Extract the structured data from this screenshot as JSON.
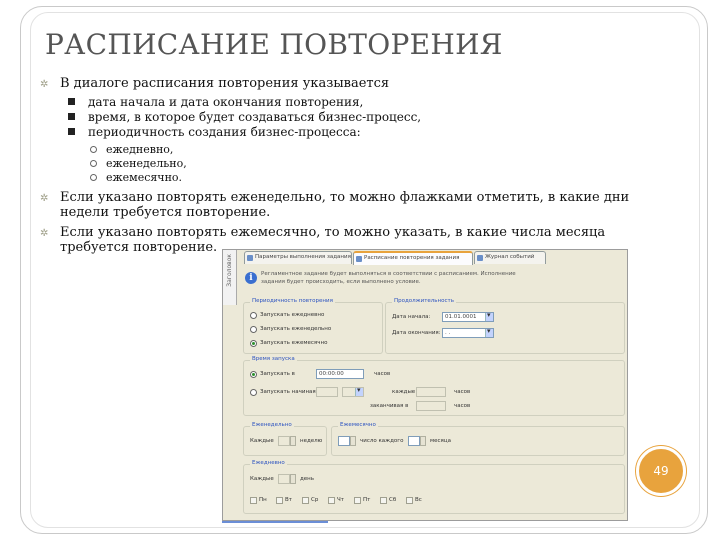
{
  "slide": {
    "title": "РАСПИСАНИЕ ПОВТОРЕНИЯ",
    "page_number": "49",
    "accent_color": "#e8a33d",
    "bullet_icon": "diamond-bullet-icon"
  },
  "bullets": {
    "intro": "В диалоге расписания повторения указывается",
    "sub": [
      "дата начала и дата окончания повторения,",
      "время, в которое будет создаваться бизнес-процесс,",
      "периодичность создания бизнес-процесса:"
    ],
    "subsub": [
      "ежедневно,",
      "еженедельно,",
      "ежемесячно."
    ],
    "weekly_line1": "Если указано повторять еженедельно, то можно флажками отметить, в какие дни",
    "weekly_line2": "недели требуется повторение.",
    "monthly_line1": "Если указано повторять ежемесячно, то можно указать, в какие числа месяца",
    "monthly_line2": "требуется повторение."
  },
  "dialog": {
    "side_label": "Заголовок",
    "tabs": [
      "Параметры выполнения задания",
      "Расписание повторения задания",
      "Журнал событий"
    ],
    "info_text": "Регламентное задание будет выполняться в соответствии с расписанием. Исполнение задания будет происходить, если выполнено условие.",
    "period_group": {
      "title": "Периодичность повторения",
      "options": [
        "Запускать ежедневно",
        "Запускать еженедельно",
        "Запускать ежемесячно"
      ]
    },
    "dates_group": {
      "title": "Продолжительность",
      "start_label": "Дата начала:",
      "start_value": "01.01.0001",
      "end_label": "Дата окончания:",
      "end_value": ". ."
    },
    "time_group": {
      "title": "Время запуска",
      "run_at_label": "Запускать в",
      "run_at_value": "00:00:00",
      "run_from_label": "Запускать начиная с",
      "suffix": "часов",
      "every_label": "каждые",
      "until_label": "заканчивая в"
    },
    "weekly_group": {
      "title": "Еженедельно",
      "every_label": "Каждые",
      "unit": "неделю"
    },
    "monthly_group": {
      "title": "Ежемесячно",
      "day_label": "число каждого",
      "unit": "месяца"
    },
    "daily_group": {
      "title": "Ежедневно",
      "every_label": "Каждые",
      "unit": "день",
      "weekdays": [
        "Пн",
        "Вт",
        "Ср",
        "Чт",
        "Пт",
        "Сб",
        "Вс"
      ]
    }
  }
}
